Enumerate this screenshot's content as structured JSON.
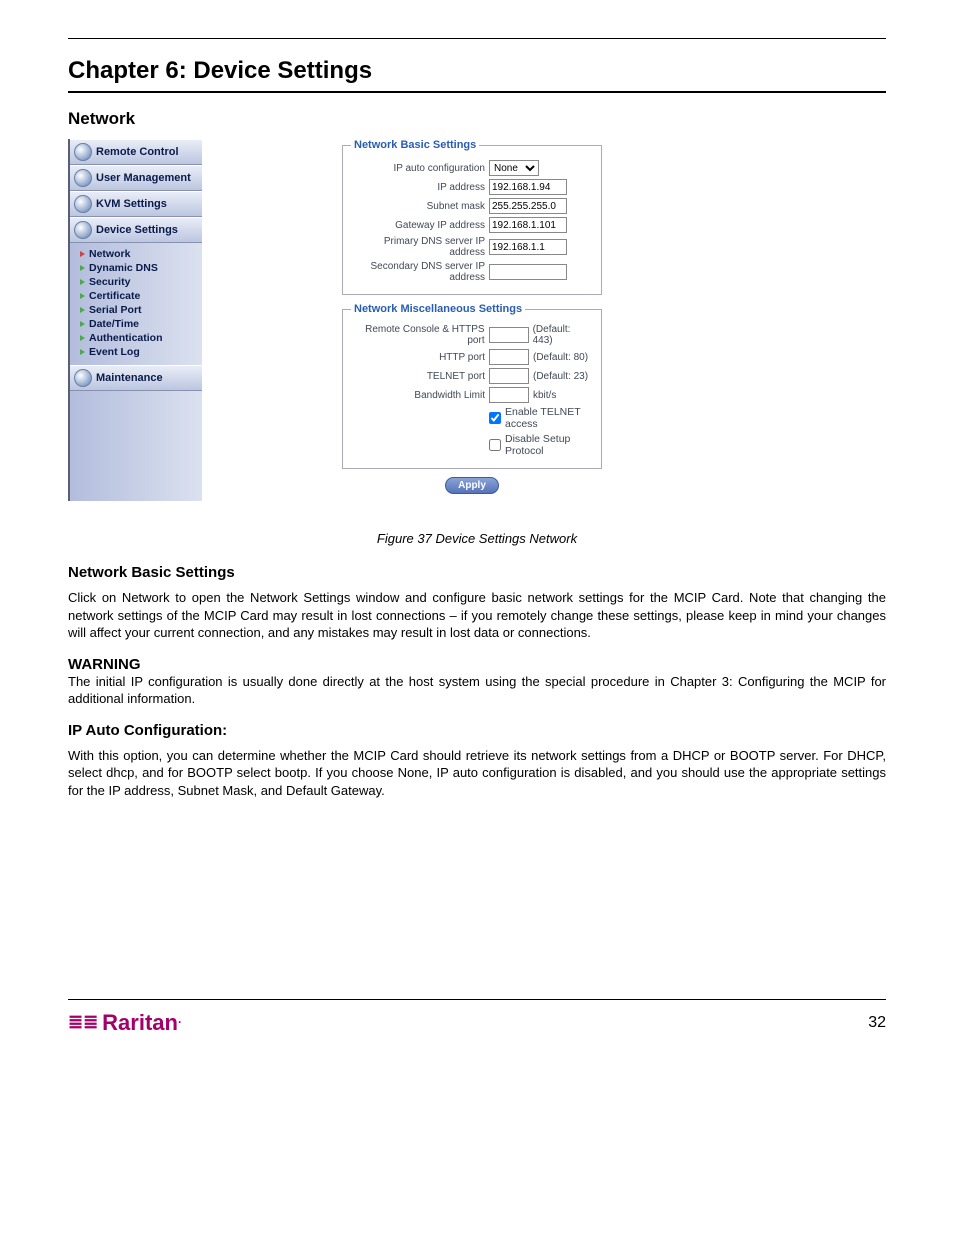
{
  "chapter_title": "Chapter 6: Device Settings",
  "section_title": "Network",
  "sidebar": {
    "buttons": [
      "Remote Control",
      "User Management",
      "KVM Settings",
      "Device Settings",
      "Maintenance"
    ],
    "sub": [
      "Network",
      "Dynamic DNS",
      "Security",
      "Certificate",
      "Serial Port",
      "Date/Time",
      "Authentication",
      "Event Log"
    ]
  },
  "panel": {
    "legend_basic": "Network Basic Settings",
    "legend_misc": "Network Miscellaneous Settings",
    "labels": {
      "ip_auto": "IP auto configuration",
      "ip_addr": "IP address",
      "subnet": "Subnet mask",
      "gateway": "Gateway IP address",
      "pdns": "Primary DNS server IP address",
      "sdns": "Secondary DNS server IP address",
      "https_port": "Remote Console & HTTPS port",
      "http_port": "HTTP port",
      "telnet_port": "TELNET port",
      "bw": "Bandwidth Limit",
      "telnet_chk": "Enable TELNET access",
      "disable_chk": "Disable Setup Protocol"
    },
    "values": {
      "ip_auto": "None",
      "ip_addr": "192.168.1.94",
      "subnet": "255.255.255.0",
      "gateway": "192.168.1.101",
      "pdns": "192.168.1.1",
      "sdns": "",
      "https_port": "",
      "http_port": "",
      "telnet_port": "",
      "bw": ""
    },
    "hints": {
      "https": "(Default: 443)",
      "http": "(Default: 80)",
      "telnet": "(Default: 23)",
      "bw": "kbit/s"
    },
    "apply": "Apply"
  },
  "caption": "Figure 37 Device Settings Network",
  "body": {
    "basic_head": "Network Basic Settings",
    "basic_text": "Click on Network to open the Network Settings window and configure basic network settings for the MCIP Card. Note that changing the network settings of the MCIP Card may result in lost connections – if you remotely change these settings, please keep in mind your changes will affect your current connection, and any mistakes may result in lost data or connections.",
    "warn_head": "WARNING",
    "warn_text": "The initial IP configuration is usually done directly at the host system using the special procedure in Chapter 3: Configuring the MCIP for additional information.",
    "ipauto_head": "IP Auto Configuration:",
    "ipauto_text": "With this option, you can determine whether the MCIP Card should retrieve its network settings from a DHCP or BOOTP server. For DHCP, select dhcp, and for BOOTP select bootp. If you choose None, IP auto configuration is disabled, and you should use the appropriate settings for the IP address, Subnet Mask, and Default Gateway."
  },
  "footer": {
    "brand": "Raritan",
    "page_no": "32"
  }
}
